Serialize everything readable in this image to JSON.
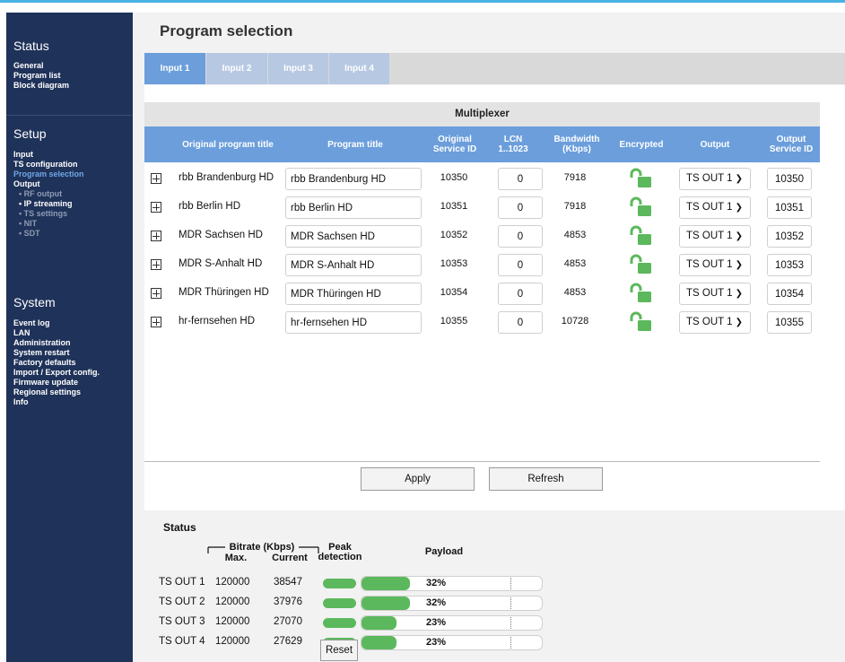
{
  "sidebar": {
    "status": {
      "title": "Status",
      "items": [
        "General",
        "Program list",
        "Block diagram"
      ]
    },
    "setup": {
      "title": "Setup",
      "input": "Input",
      "ts_configuration": "TS configuration",
      "program_selection": "Program selection",
      "output": "Output",
      "output_subs": [
        "• RF output",
        "• IP streaming",
        "• TS settings",
        "• NIT",
        "• SDT"
      ]
    },
    "system": {
      "title": "System",
      "items": [
        "Event log",
        "LAN",
        "Administration",
        "System restart",
        "Factory defaults",
        "Import / Export config.",
        "Firmware update",
        "Regional settings",
        "Info"
      ]
    }
  },
  "page_title": "Program selection",
  "tabs": [
    "Input 1",
    "Input 2",
    "Input 3",
    "Input 4"
  ],
  "active_tab": "Input 1",
  "multiplexer": {
    "title": "Multiplexer",
    "columns": {
      "original_title": "Original program title",
      "program_title": "Program title",
      "original_sid": "Original Service ID",
      "lcn": "LCN 1..1023",
      "bandwidth": "Bandwidth (Kbps)",
      "encrypted": "Encrypted",
      "output": "Output",
      "output_sid": "Output Service ID"
    },
    "rows": [
      {
        "original_title": "rbb Brandenburg HD",
        "program_title": "rbb Brandenburg HD",
        "original_sid": "10350",
        "lcn": "0",
        "bandwidth": "7918",
        "encrypted_icon": "unlocked-padlock-icon",
        "output": "TS OUT 1",
        "output_sid": "10350"
      },
      {
        "original_title": "rbb Berlin HD",
        "program_title": "rbb Berlin HD",
        "original_sid": "10351",
        "lcn": "0",
        "bandwidth": "7918",
        "encrypted_icon": "unlocked-padlock-icon",
        "output": "TS OUT 1",
        "output_sid": "10351"
      },
      {
        "original_title": "MDR Sachsen HD",
        "program_title": "MDR Sachsen HD",
        "original_sid": "10352",
        "lcn": "0",
        "bandwidth": "4853",
        "encrypted_icon": "unlocked-padlock-icon",
        "output": "TS OUT 1",
        "output_sid": "10352"
      },
      {
        "original_title": "MDR S-Anhalt HD",
        "program_title": "MDR S-Anhalt HD",
        "original_sid": "10353",
        "lcn": "0",
        "bandwidth": "4853",
        "encrypted_icon": "unlocked-padlock-icon",
        "output": "TS OUT 1",
        "output_sid": "10353"
      },
      {
        "original_title": "MDR Thüringen HD",
        "program_title": "MDR Thüringen HD",
        "original_sid": "10354",
        "lcn": "0",
        "bandwidth": "4853",
        "encrypted_icon": "unlocked-padlock-icon",
        "output": "TS OUT 1",
        "output_sid": "10354"
      },
      {
        "original_title": "hr-fernsehen HD",
        "program_title": "hr-fernsehen HD",
        "original_sid": "10355",
        "lcn": "0",
        "bandwidth": "10728",
        "encrypted_icon": "unlocked-padlock-icon",
        "output": "TS OUT 1",
        "output_sid": "10355"
      }
    ]
  },
  "buttons": {
    "apply": "Apply",
    "refresh": "Refresh",
    "reset": "Reset"
  },
  "status": {
    "title": "Status",
    "bitrate_label": "Bitrate (Kbps)",
    "max_label": "Max.",
    "current_label": "Current",
    "peak_label": "Peak detection",
    "payload_label": "Payload",
    "rows": [
      {
        "name": "TS OUT 1",
        "max": "120000",
        "current": "38547",
        "payload": "32%",
        "payload_fraction": 0.32
      },
      {
        "name": "TS OUT 2",
        "max": "120000",
        "current": "37976",
        "payload": "32%",
        "payload_fraction": 0.32
      },
      {
        "name": "TS OUT 3",
        "max": "120000",
        "current": "27070",
        "payload": "23%",
        "payload_fraction": 0.23
      },
      {
        "name": "TS OUT 4",
        "max": "120000",
        "current": "27629",
        "payload": "23%",
        "payload_fraction": 0.23
      }
    ]
  },
  "colors": {
    "accent": "#6b9edb",
    "sidebar": "#1f3259",
    "ok_green": "#5cb85c"
  }
}
